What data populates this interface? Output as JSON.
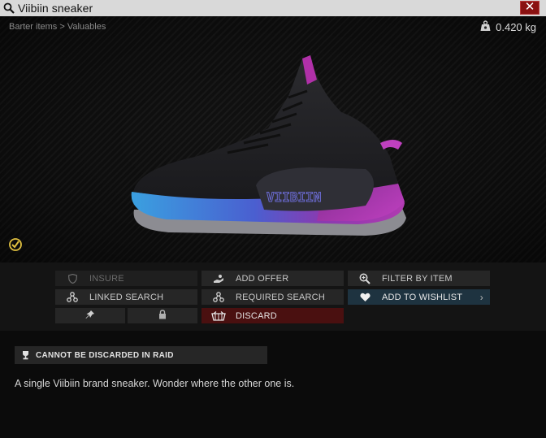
{
  "window": {
    "title": "Viibiin sneaker",
    "close_label": "✕"
  },
  "item": {
    "breadcrumb": "Barter items > Valuables",
    "weight": "0.420 kg",
    "brand_text": "VIIBIIN"
  },
  "actions": {
    "insure": "INSURE",
    "add_offer": "ADD OFFER",
    "filter_by_item": "FILTER BY ITEM",
    "linked_search": "LINKED SEARCH",
    "required_search": "REQUIRED SEARCH",
    "add_to_wishlist": "ADD TO WISHLIST",
    "discard": "DISCARD",
    "wishlist_chevron": "›"
  },
  "details": {
    "warning": "CANNOT BE DISCARDED IN RAID",
    "description": "A single Viibiin brand sneaker. Wonder where the other one is."
  },
  "colors": {
    "discard_bg": "#4a1010",
    "wishlist_bg": "#1e3340",
    "examined_icon": "#e0c040",
    "close_bg": "#8a1111"
  },
  "icons": {
    "title": "search-icon",
    "close": "close-icon",
    "weight": "weight-icon",
    "examined": "examined-check-icon",
    "insure": "shield-icon",
    "add_offer": "hand-offer-icon",
    "filter": "magnifier-plus-icon",
    "linked": "linked-search-icon",
    "required": "required-search-icon",
    "wishlist": "heart-icon",
    "pin": "pin-icon",
    "lock": "lock-icon",
    "discard": "discard-basket-icon",
    "warning": "trophy-icon"
  }
}
